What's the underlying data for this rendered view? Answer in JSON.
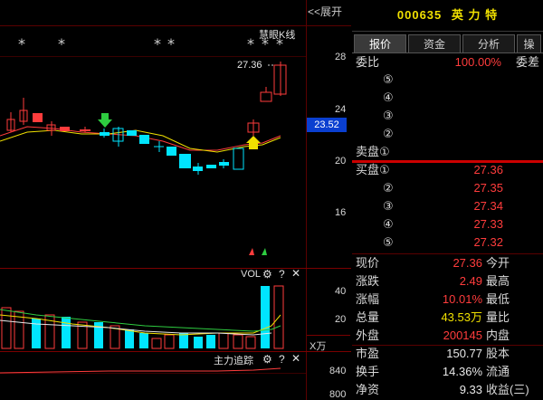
{
  "header": {
    "expand_label": "<<展开",
    "indicator_name": "慧眼K线"
  },
  "price_axis": {
    "ticks": [
      "28",
      "24",
      "20",
      "16"
    ],
    "current_price": "23.52",
    "high_label": "27.36"
  },
  "volume_panel": {
    "name": "VOL",
    "ticks": [
      "40",
      "20"
    ],
    "unit": "X万"
  },
  "flow_panel": {
    "name": "主力追踪",
    "ticks": [
      "840",
      "800"
    ]
  },
  "colors": {
    "up": "#ff3c3c",
    "down": "#00e5ff",
    "axis_grid": "#5a0000",
    "accent": "#0a3fd0"
  },
  "icons": [
    "gear-icon",
    "help-icon",
    "close-icon"
  ],
  "stock": {
    "code": "000635",
    "name": "英 力 特"
  },
  "tabs": [
    "报价",
    "资金",
    "分析",
    "操"
  ],
  "order_book": {
    "ratio_label": "委比",
    "ratio_value": "100.00%",
    "diff_label": "委差",
    "asks": [
      {
        "label": "⑤"
      },
      {
        "label": "④"
      },
      {
        "label": "③"
      },
      {
        "label": "②"
      },
      {
        "label": "卖盘①"
      }
    ],
    "bids": [
      {
        "label": "买盘①",
        "price": "27.36"
      },
      {
        "label": "②",
        "price": "27.35"
      },
      {
        "label": "③",
        "price": "27.34"
      },
      {
        "label": "④",
        "price": "27.33"
      },
      {
        "label": "⑤",
        "price": "27.32"
      }
    ]
  },
  "quote": {
    "now_label": "现价",
    "now_value": "27.36",
    "open_label": "今开",
    "chg_label": "涨跌",
    "chg_value": "2.49",
    "high_label": "最高",
    "pct_label": "涨幅",
    "pct_value": "10.01%",
    "low_label": "最低",
    "vol_label": "总量",
    "vol_value": "43.53万",
    "vr_label": "量比",
    "out_label": "外盘",
    "out_value": "200145",
    "in_label": "内盘",
    "pe_label": "市盈",
    "pe_value": "150.77",
    "equity_label": "股本",
    "turn_label": "换手",
    "turn_value": "14.36%",
    "float_label": "流通",
    "nav_label": "净资",
    "nav_value": "9.33",
    "eps_label": "收益(三)"
  }
}
